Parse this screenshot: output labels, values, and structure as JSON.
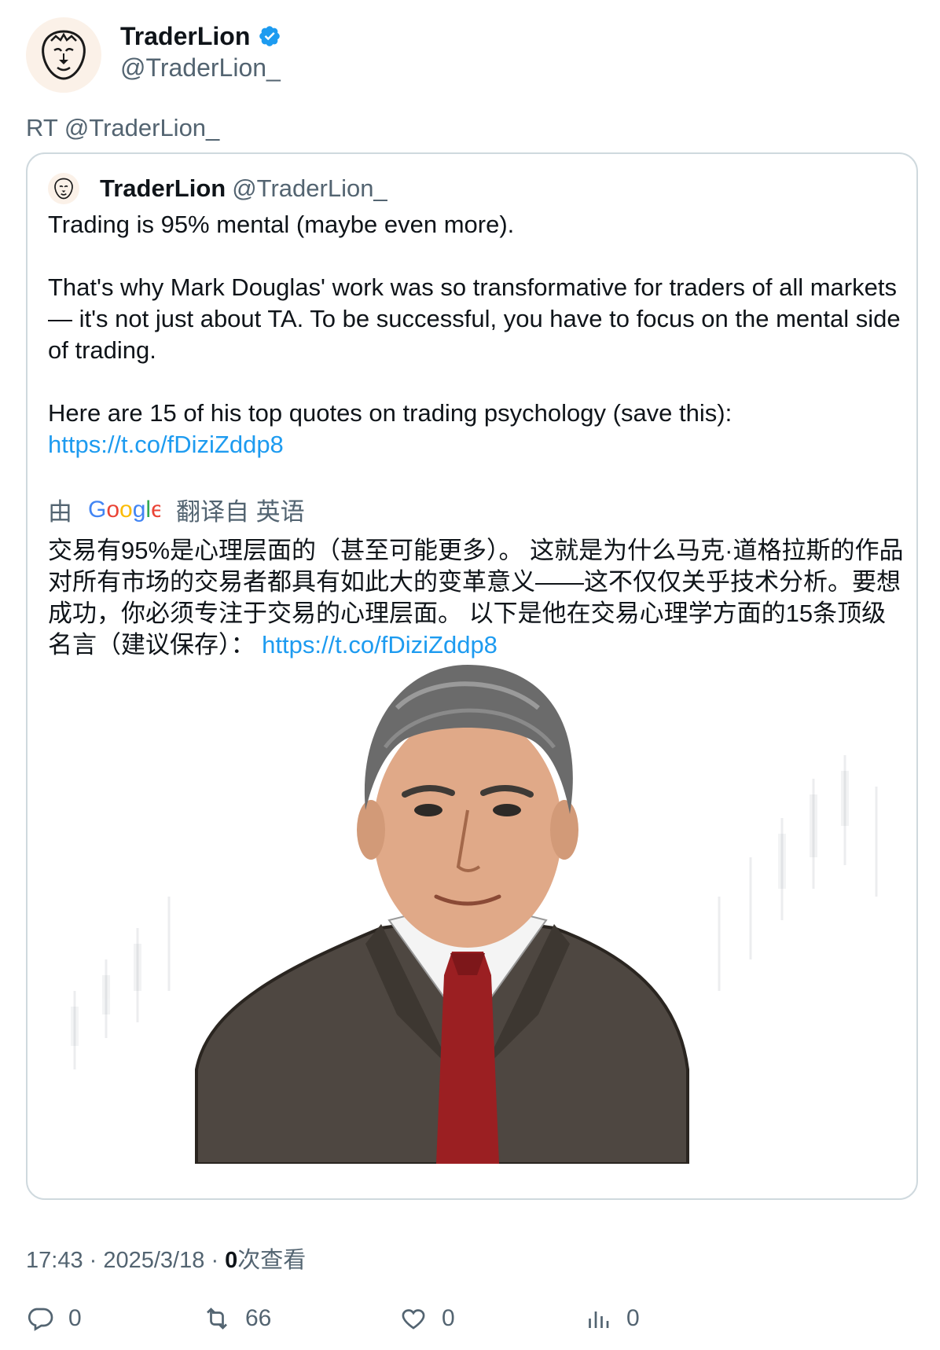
{
  "author": {
    "display_name": "TraderLion",
    "handle": "@TraderLion_",
    "avatar_icon": "lion-logo-icon",
    "verified": true
  },
  "retweet_line": "RT @TraderLion_",
  "quoted": {
    "display_name": "TraderLion",
    "handle": "@TraderLion_",
    "para1": "Trading is 95% mental (maybe even more).",
    "para2": "That's why Mark Douglas' work was so transformative for traders of all markets — it's not just about TA. To be successful, you have to focus on the mental side of trading.",
    "para3": "Here are 15 of his top quotes on trading psychology (save this):",
    "link": "https://t.co/fDiziZddp8",
    "translate_prefix": "由",
    "translate_brand": "Google",
    "translate_suffix": "翻译自 英语",
    "translated_text": "交易有95%是心理层面的（甚至可能更多）。 这就是为什么马克·道格拉斯的作品对所有市场的交易者都具有如此大的变革意义——这不仅仅关乎技术分析。要想成功，你必须专注于交易的心理层面。 以下是他在交易心理学方面的15条顶级名言（建议保存）：",
    "translated_link": "https://t.co/fDiziZddp8"
  },
  "meta": {
    "time": "17:43",
    "date": "2025/3/18",
    "views_count": "0",
    "views_label": "次查看"
  },
  "actions": {
    "replies": "0",
    "retweets": "66",
    "likes": "0",
    "views": "0"
  },
  "colors": {
    "link": "#1d9bf0",
    "secondary_text": "#536471",
    "verified": "#1d9bf0",
    "border": "#cfd9de"
  }
}
